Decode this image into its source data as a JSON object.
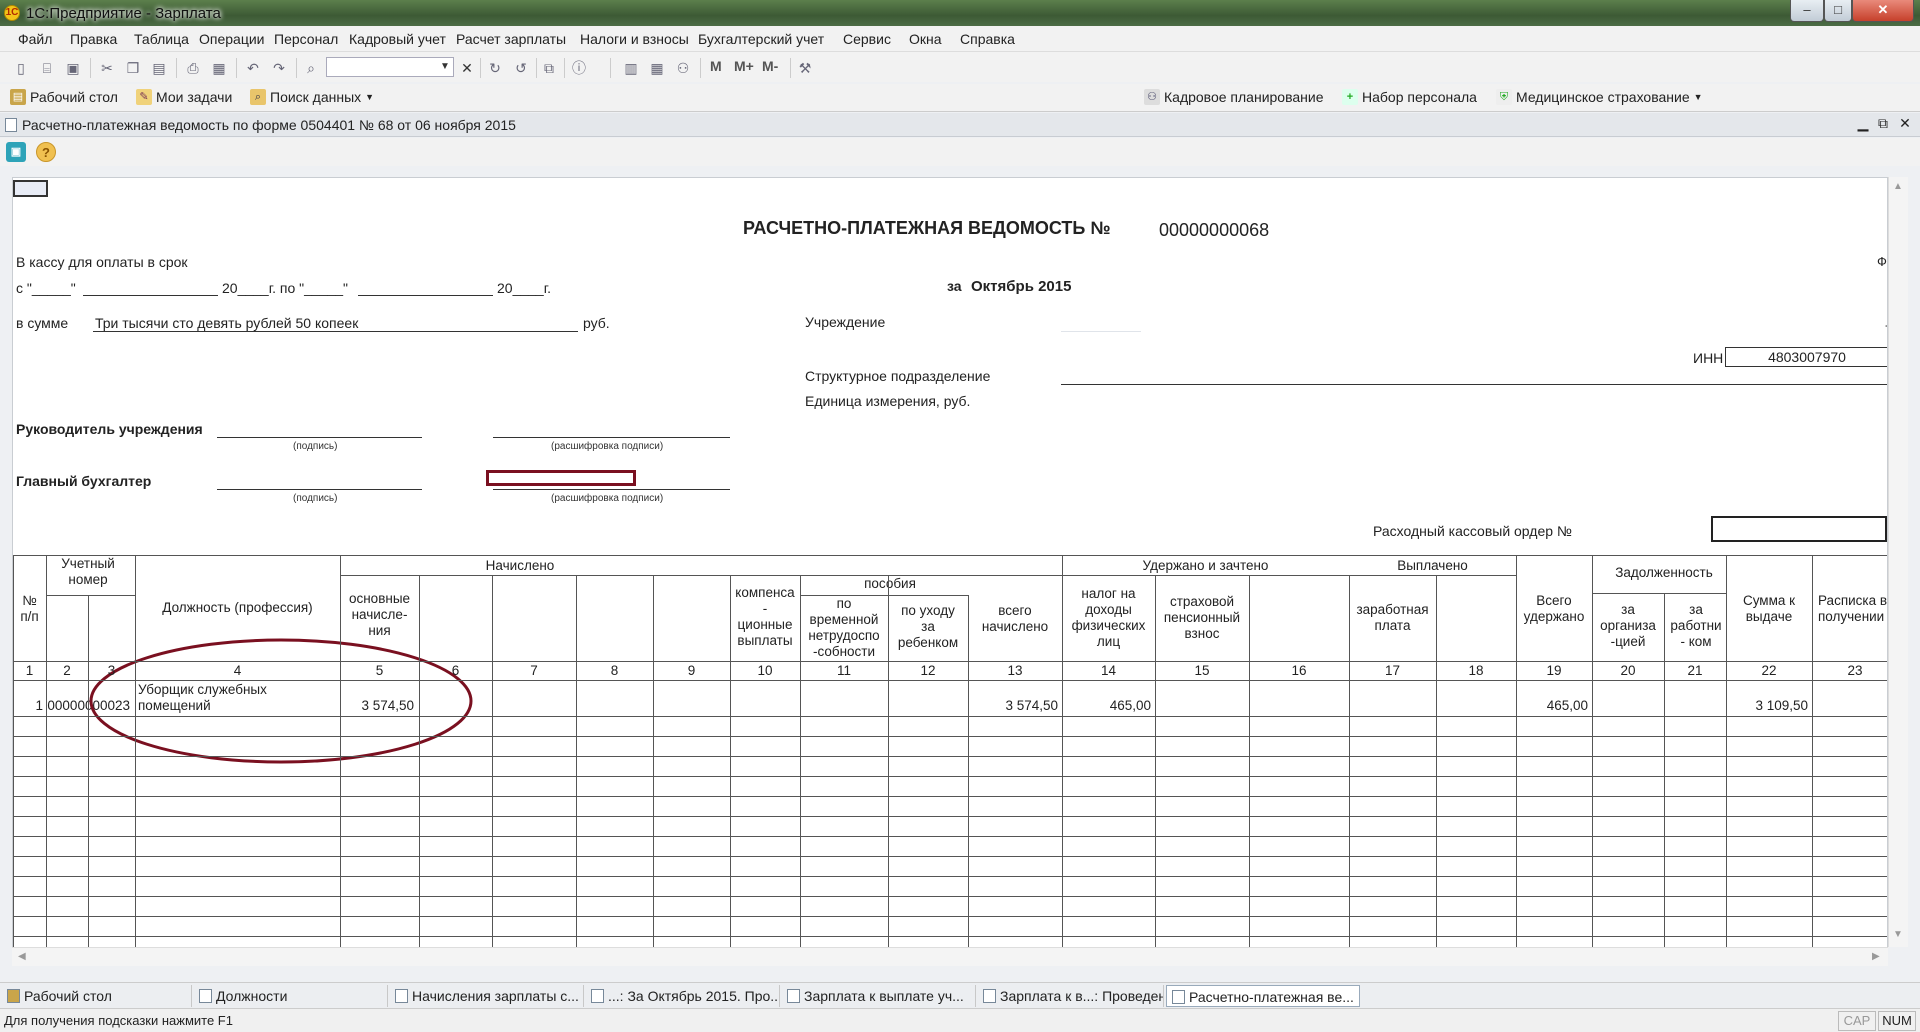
{
  "app": {
    "title": "1С:Предприятие - Зарплата",
    "logo_text": "1С"
  },
  "window_controls": {
    "minimize": "–",
    "maximize": "□",
    "close": "✕"
  },
  "menu": [
    "Файл",
    "Правка",
    "Таблица",
    "Операции",
    "Персонал",
    "Кадровый учет",
    "Расчет зарплаты",
    "Налоги и взносы",
    "Бухгалтерский учет",
    "Сервис",
    "Окна",
    "Справка"
  ],
  "toolbar": {
    "m": "M",
    "m_plus": "M+",
    "m_minus": "M-",
    "search_value": ""
  },
  "panel": {
    "left": [
      {
        "label": "Рабочий стол",
        "icon": "desktop-icon"
      },
      {
        "label": "Мои задачи",
        "icon": "tasks-icon"
      },
      {
        "label": "Поиск данных",
        "icon": "search-data-icon"
      }
    ],
    "right": [
      {
        "label": "Кадровое планирование",
        "icon": "staff-planning-icon"
      },
      {
        "label": "Набор персонала",
        "icon": "recruiting-icon"
      },
      {
        "label": "Медицинское страхование",
        "icon": "medical-insurance-icon"
      }
    ]
  },
  "document": {
    "title": "Расчетно-платежная ведомость по форме 0504401 № 68 от 06 ноября 2015",
    "heading": "РАСЧЕТНО-ПЛАТЕЖНАЯ ВЕДОМОСТЬ №",
    "number": "00000000068",
    "cashier_line": "В кассу для оплаты в срок",
    "date_from": "с \"_____\"",
    "date_year1": "20____г. по \"_____\"",
    "date_year2": "20____г.",
    "period_label": "за",
    "period": "Октябрь 2015",
    "sum_label": "в сумме",
    "sum_words": "Три тысячи сто девять рублей 50 копеек",
    "rub": "руб.",
    "institution_label": "Учреждение",
    "subdivision_label": "Структурное подразделение",
    "unit_label": "Единица измерения, руб.",
    "inn_label": "ИНН",
    "inn": "4803007970",
    "head_label": "Руководитель учреждения",
    "chief_acc_label": "Главный бухгалтер",
    "sign_caption": "(подпись)",
    "decode_caption": "(расшифровка подписи)",
    "cash_order_label": "Расходный кассовый ордер №",
    "edge_letter": "Ф",
    "edge_dash": "-"
  },
  "table": {
    "group_headers": {
      "accrued": "Начислено",
      "withheld": "Удержано и зачтено",
      "paid": "Выплачено",
      "debt": "Задолженность",
      "benefits": "пособия"
    },
    "col_headers": {
      "c1": "№\nп/п",
      "c2": "Учетный\nномер",
      "c4": "Должность (профессия)",
      "c5": "основные\nначисле-\nния",
      "c10": "компенса\n-\nционные\nвыплаты",
      "c11": "по\nвременной\nнетрудоспо\n-собности",
      "c12": "по уходу\nза\nребенком",
      "c13": "всего\nначислено",
      "c14": "налог на\nдоходы\nфизических\nлиц",
      "c15": "страховой\nпенсионный\nвзнос",
      "c17": "заработная\nплата",
      "c19": "Всего\nудержано",
      "c20": "за\nорганиза\n-цией",
      "c21": "за\nработни\n- ком",
      "c22": "Сумма к\nвыдаче",
      "c23": "Расписка в\nполучении"
    },
    "col_numbers": [
      "1",
      "2",
      "3",
      "4",
      "5",
      "6",
      "7",
      "8",
      "9",
      "10",
      "11",
      "12",
      "13",
      "14",
      "15",
      "16",
      "17",
      "18",
      "19",
      "20",
      "21",
      "22",
      "23"
    ],
    "row": {
      "n": "1",
      "account": "00000000023",
      "position": "Уборщик служебных\nпомещений",
      "basic": "3 574,50",
      "total_accrued": "3 574,50",
      "ndfl": "465,00",
      "total_withheld": "465,00",
      "to_pay": "3 109,50"
    }
  },
  "taskbar": [
    {
      "label": "Рабочий стол",
      "active": false
    },
    {
      "label": "Должности",
      "active": false
    },
    {
      "label": "Начисления зарплаты с...",
      "active": false
    },
    {
      "label": "...: За Октябрь 2015. Про...",
      "active": false
    },
    {
      "label": "Зарплата к выплате уч...",
      "active": false
    },
    {
      "label": "Зарплата к в...: Проведен",
      "active": false
    },
    {
      "label": "Расчетно-платежная ве...",
      "active": true
    }
  ],
  "status": {
    "hint": "Для получения подсказки нажмите F1",
    "cap": "CAP",
    "num": "NUM"
  },
  "colors": {
    "annotation": "#7a1020",
    "titlebar": "#4c6c45",
    "grid": "#555555"
  }
}
